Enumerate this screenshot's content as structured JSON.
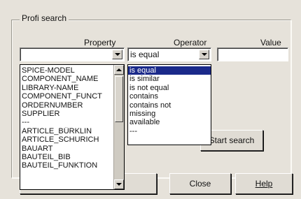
{
  "dialog": {
    "group_title": "Profi search",
    "property_label": "Property",
    "operator_label": "Operator",
    "value_label": "Value"
  },
  "property": {
    "selected": "",
    "options": [
      "SPICE-MODEL",
      "COMPONENT_NAME",
      "LIBRARY-NAME",
      "COMPONENT_FUNCT",
      "ORDERNUMBER",
      "SUPPLIER",
      "---",
      "ARTICLE_BÜRKLIN",
      "ARTICLE_SCHURICH",
      "BAUART",
      "BAUTEIL_BIB",
      "BAUTEIL_FUNKTION"
    ]
  },
  "operator": {
    "selected": "is equal",
    "highlighted_index": 0,
    "options": [
      "is equal",
      "is similar",
      "is not equal",
      "contains",
      "contains not",
      "missing",
      "available",
      "---"
    ]
  },
  "value": {
    "text": ""
  },
  "buttons": {
    "start_search": "Start search",
    "close": "Close",
    "help": "Help"
  },
  "icons": {
    "dropdown": "chevron-down-icon",
    "scroll_up": "arrow-up-icon",
    "scroll_down": "arrow-down-icon"
  }
}
